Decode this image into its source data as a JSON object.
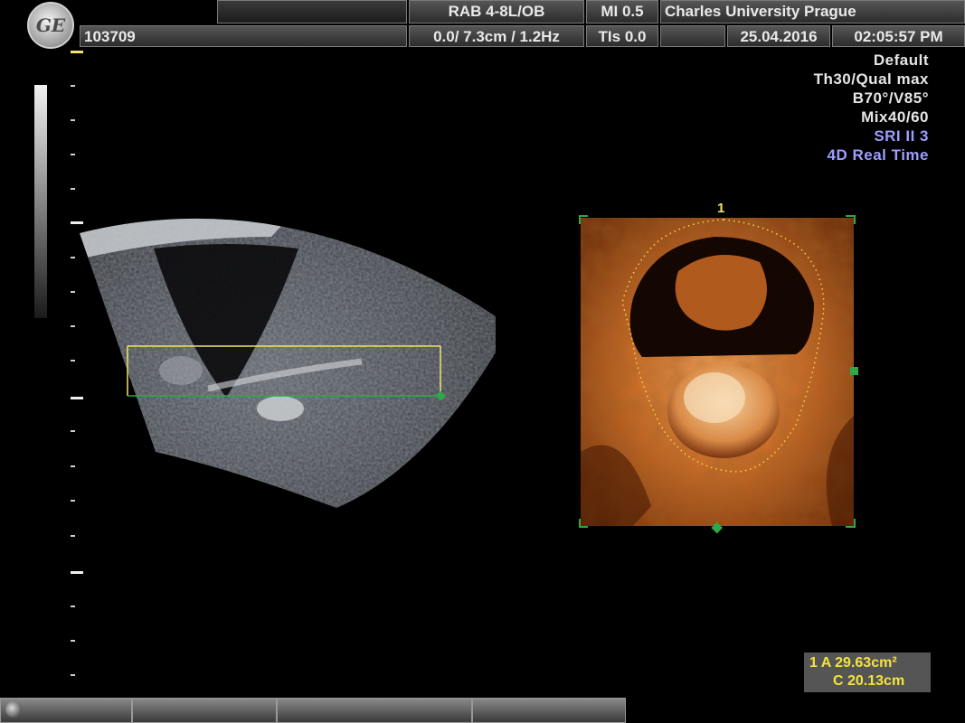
{
  "header": {
    "probe": "RAB 4-8L/OB",
    "mi": "MI  0.5",
    "institution": "Charles University Prague",
    "patient_id": "103709",
    "depth_freq": "0.0/ 7.3cm / 1.2Hz",
    "tis": "TIs  0.0",
    "date": "25.04.2016",
    "time": "02:05:57 PM"
  },
  "params": [
    "Default",
    "Th30/Qual max",
    "B70°/V85°",
    "Mix40/60",
    "SRI II 3",
    "4D Real Time"
  ],
  "render_label": "1",
  "measurement": {
    "area": "1   A 29.63cm²",
    "circumference": "C  20.13cm"
  },
  "colors": {
    "header_text": "#e9e9e9",
    "param_blue": "#9d9dff",
    "roi_green": "#2ea84a",
    "roi_yellow": "#f2e46a",
    "measure_yellow": "#f4e43a",
    "render_orange": "#d9772d"
  },
  "icons": [
    "ge-logo-icon",
    "trackball-knob-icon"
  ]
}
